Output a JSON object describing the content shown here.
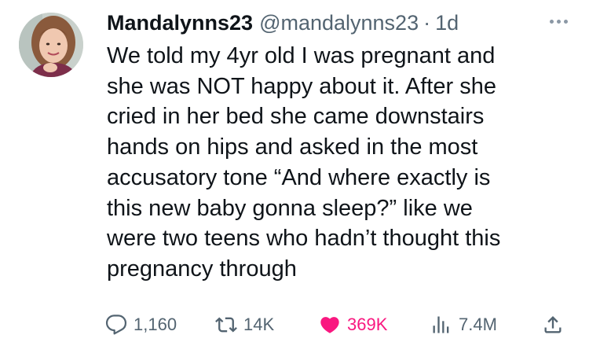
{
  "tweet": {
    "author": {
      "display_name": "Mandalynns23",
      "handle": "@mandalynns23",
      "time_separator": "·",
      "time_ago": "1d"
    },
    "text": "We told my 4yr old I was pregnant and\nshe was NOT happy about it. After she\ncried in her bed she came downstairs\nhands on hips and asked in the most\naccusatory tone “And where exactly is\nthis new baby gonna sleep?” like we\nwere two teens who hadn’t thought this\npregnancy through",
    "actions": {
      "reply_count": "1,160",
      "retweet_count": "14K",
      "like_count": "369K",
      "views_count": "7.4M"
    }
  },
  "colors": {
    "text_primary": "#0f1419",
    "text_secondary": "#536471",
    "like_active": "#f91880"
  },
  "icons": {
    "more": "more-options-icon",
    "reply": "reply-icon",
    "retweet": "retweet-icon",
    "like": "heart-icon",
    "views": "views-icon",
    "share": "share-icon"
  }
}
